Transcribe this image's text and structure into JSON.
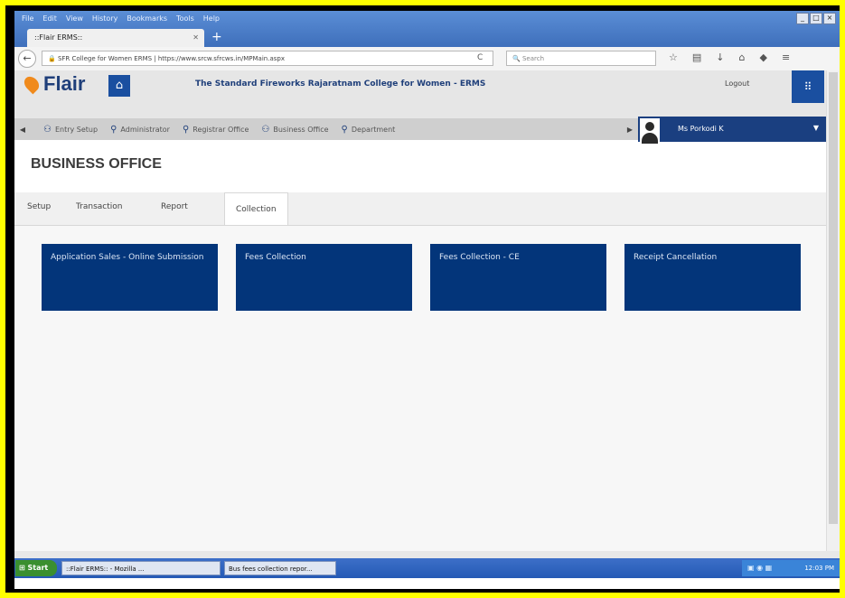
{
  "browser": {
    "menu": [
      "File",
      "Edit",
      "View",
      "History",
      "Bookmarks",
      "Tools",
      "Help"
    ],
    "tab_title": "::Flair ERMS::",
    "url": "SFR College for Women ERMS | https://www.srcw.sfrcws.in/MPMain.aspx",
    "search_placeholder": "Search",
    "window_buttons": [
      "_",
      "□",
      "×"
    ]
  },
  "app": {
    "logo": "Flair",
    "college": "The Standard Fireworks Rajaratnam College for Women - ERMS",
    "logout": "Logout",
    "modules": [
      "Entry Setup",
      "Administrator",
      "Registrar Office",
      "Business Office",
      "Department"
    ],
    "user": "Ms Porkodi K"
  },
  "page": {
    "title": "BUSINESS OFFICE",
    "tabs": [
      "Setup",
      "Transaction",
      "Report",
      "Collection"
    ],
    "tiles": [
      "Application Sales - Online Submission",
      "Fees Collection",
      "Fees Collection - CE",
      "Receipt Cancellation"
    ]
  },
  "taskbar": {
    "start": "Start",
    "tasks": [
      "::Flair ERMS:: - Mozilla ...",
      "Bus fees collection repor..."
    ],
    "clock": "12:03 PM"
  },
  "colors": {
    "accent": "#1a4fa0",
    "tile": "#03357a",
    "frame": "#ffff00"
  }
}
